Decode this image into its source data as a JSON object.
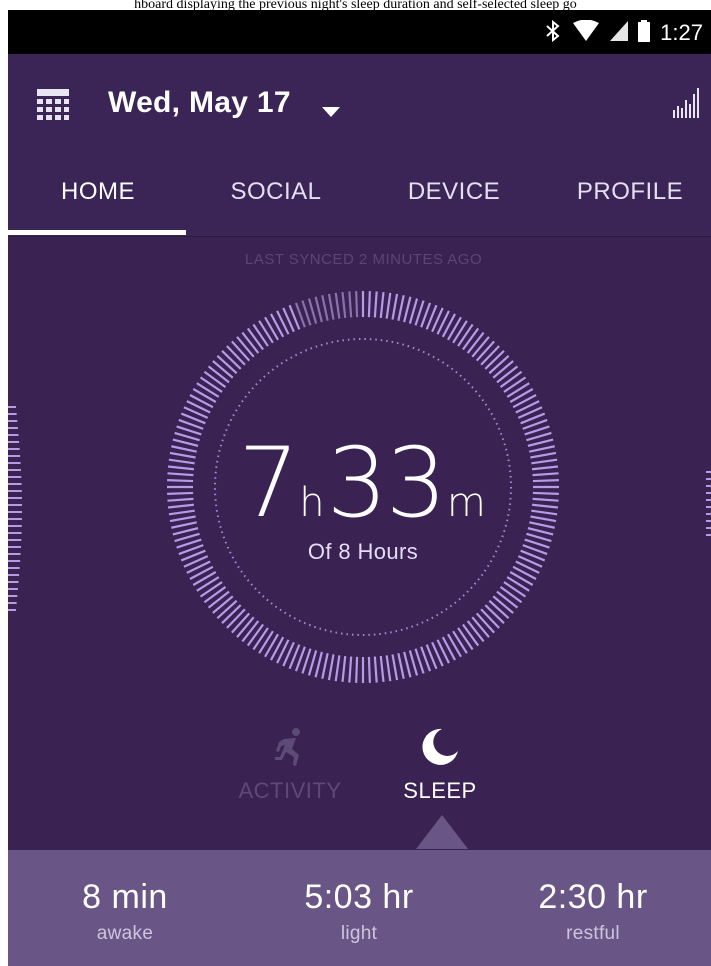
{
  "caption": "hboard displaying the previous night's sleep duration and self-selected sleep go",
  "status_bar": {
    "time": "1:27",
    "icons": [
      "bluetooth-icon",
      "wifi-icon",
      "cell-signal-icon",
      "battery-icon"
    ]
  },
  "app_bar": {
    "date": "Wed, May 17",
    "icons": [
      "calendar-icon",
      "chevron-down-icon",
      "bar-chart-icon"
    ]
  },
  "tabs": [
    {
      "label": "HOME",
      "active": true
    },
    {
      "label": "SOCIAL",
      "active": false
    },
    {
      "label": "DEVICE",
      "active": false
    },
    {
      "label": "PROFILE",
      "active": false
    }
  ],
  "sync_status": "LAST SYNCED 2 MINUTES AGO",
  "sleep": {
    "hours": "7",
    "hours_unit": "h",
    "minutes": "33",
    "minutes_unit": "m",
    "goal": "Of 8  Hours",
    "progress": 0.94
  },
  "modes": [
    {
      "label": "ACTIVITY",
      "icon": "running-person-icon",
      "selected": false
    },
    {
      "label": "SLEEP",
      "icon": "moon-icon",
      "selected": true
    }
  ],
  "breakdown": [
    {
      "value": "8 min",
      "label": "awake"
    },
    {
      "value": "5:03 hr",
      "label": "light"
    },
    {
      "value": "2:30 hr",
      "label": "restful"
    }
  ],
  "colors": {
    "background": "#3a2252",
    "ring": "#b79ae6",
    "ring_remaining": "#8a72ad",
    "bottom_panel": "#6a5686"
  }
}
